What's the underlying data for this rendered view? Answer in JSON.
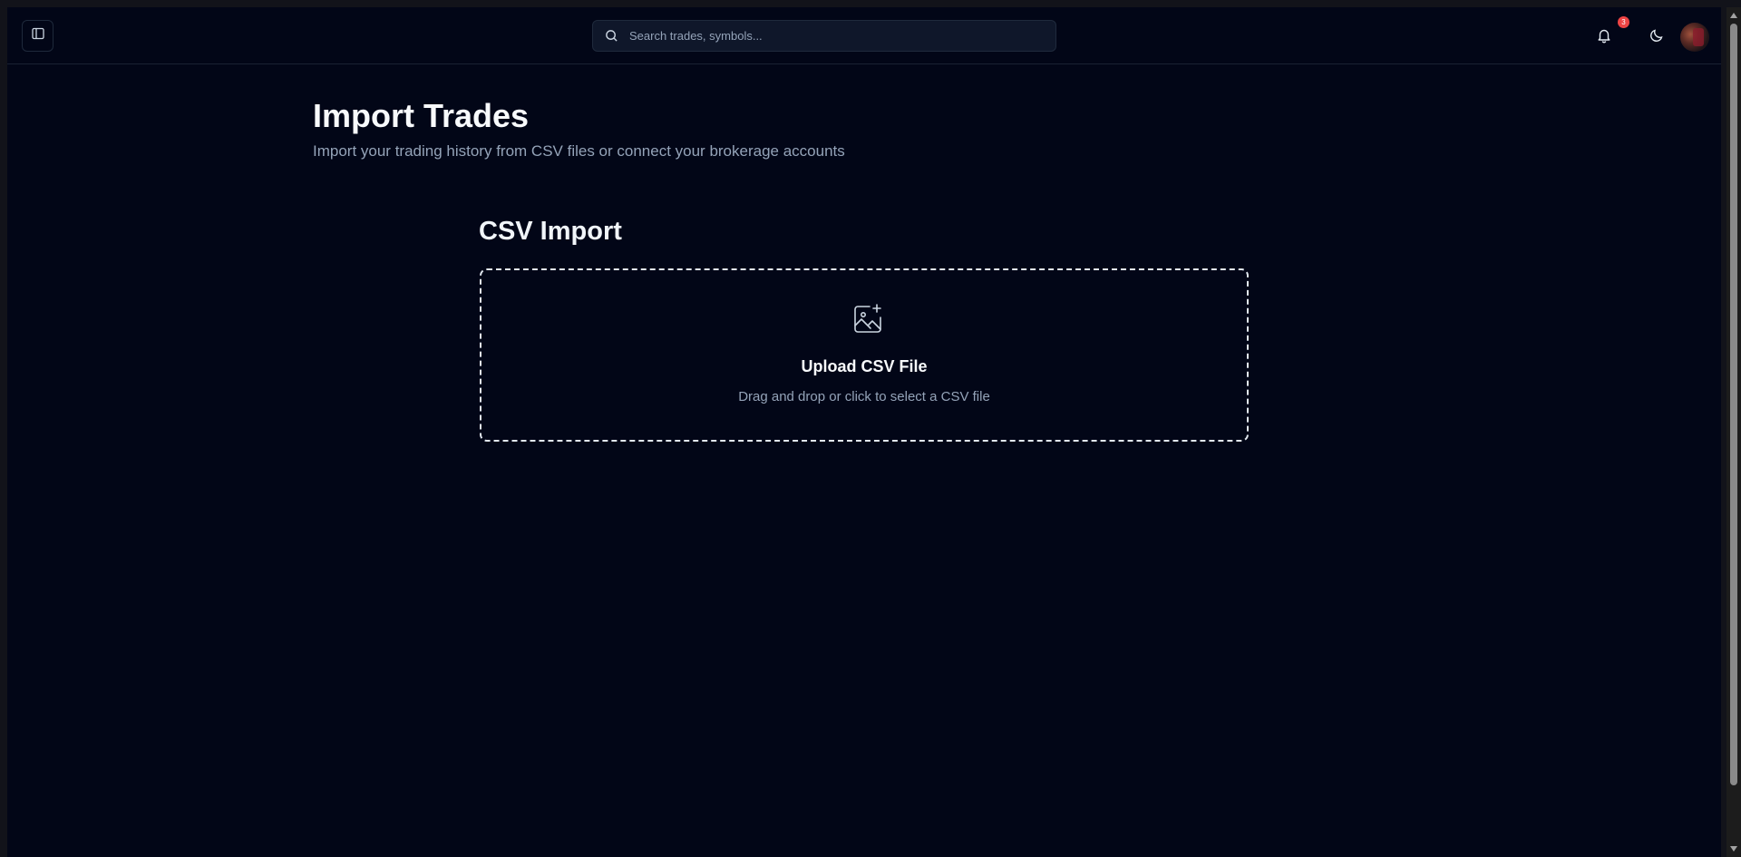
{
  "header": {
    "search": {
      "placeholder": "Search trades, symbols...",
      "value": ""
    },
    "notifications": {
      "count": "3",
      "icon": "bell-icon"
    },
    "theme_toggle_icon": "moon-icon",
    "sidebar_toggle_icon": "sidebar-panel-icon"
  },
  "page": {
    "title": "Import Trades",
    "subtitle": "Import your trading history from CSV files or connect your brokerage accounts"
  },
  "csv_import": {
    "section_title": "CSV Import",
    "upload_title": "Upload CSV File",
    "upload_hint": "Drag and drop or click to select a CSV file",
    "icon": "image-plus-icon"
  },
  "colors": {
    "background": "#020617",
    "badge": "#ef4444",
    "text_primary": "#f8fafc",
    "text_muted": "#94a3b8"
  }
}
